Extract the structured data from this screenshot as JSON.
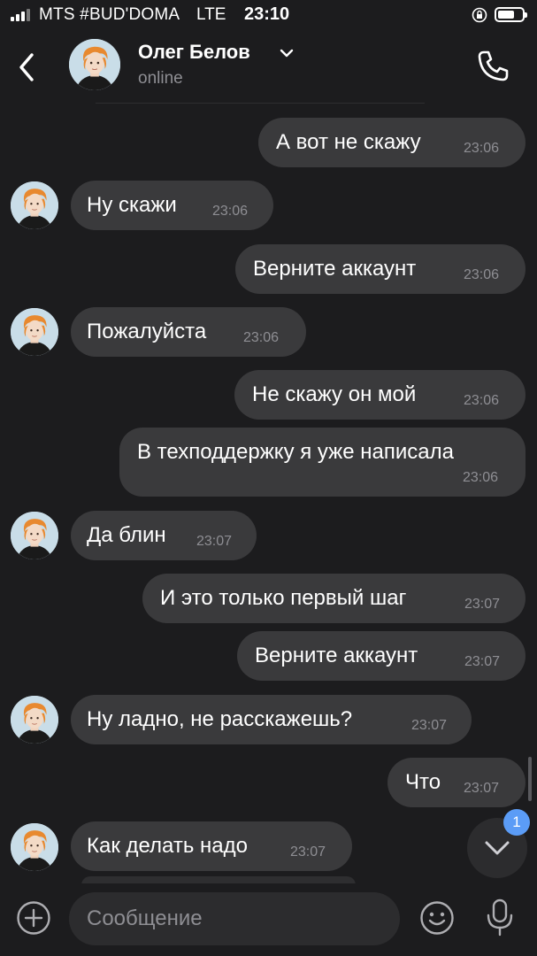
{
  "status_bar": {
    "carrier": "MTS #BUD'DOMA",
    "network": "LTE",
    "time": "23:10"
  },
  "header": {
    "name": "Олег Белов",
    "status": "online",
    "back_icon": "chevron-left-icon",
    "call_icon": "phone-icon"
  },
  "messages": [
    {
      "dir": "out",
      "text": "А вот не скажу",
      "time": "23:06"
    },
    {
      "dir": "in",
      "text": "Ну скажи",
      "time": "23:06"
    },
    {
      "dir": "out",
      "text": "Верните аккаунт",
      "time": "23:06"
    },
    {
      "dir": "in",
      "text": "Пожалуйста",
      "time": "23:06"
    },
    {
      "dir": "out",
      "text": "Не скажу он мой",
      "time": "23:06"
    },
    {
      "dir": "out",
      "text": "В техподдержку я уже написала",
      "time": "23:06"
    },
    {
      "dir": "in",
      "text": "Да блин",
      "time": "23:07"
    },
    {
      "dir": "out",
      "text": "И это только первый шаг",
      "time": "23:07"
    },
    {
      "dir": "out",
      "text": "Верните аккаунт",
      "time": "23:07"
    },
    {
      "dir": "in",
      "text": "Ну ладно, не расскажешь?",
      "time": "23:07"
    },
    {
      "dir": "out",
      "text": "Что",
      "time": "23:07"
    },
    {
      "dir": "in",
      "text": "Как делать надо",
      "time": "23:07"
    }
  ],
  "scroll_button": {
    "badge": "1"
  },
  "composer": {
    "placeholder": "Сообщение"
  },
  "colors": {
    "background": "#1c1c1e",
    "bubble": "#3a3a3c",
    "badge": "#5b9cf6",
    "muted": "#8e8e93"
  }
}
